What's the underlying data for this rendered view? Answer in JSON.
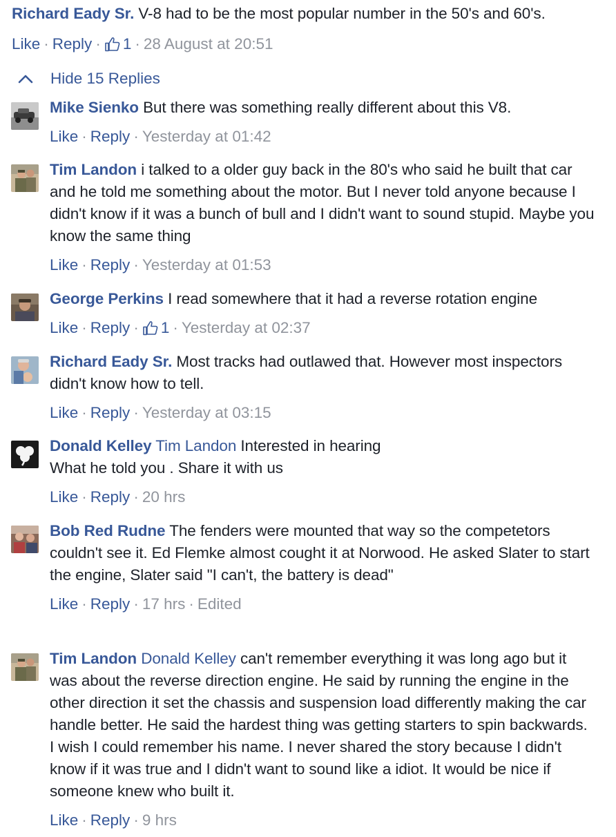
{
  "top_comment": {
    "author": "Richard Eady Sr.",
    "text": "V-8 had to be the most popular number in the 50's and 60's.",
    "like_label": "Like",
    "reply_label": "Reply",
    "like_count": "1",
    "time": "28 August at 20:51"
  },
  "hide_replies_label": "Hide 15 Replies",
  "replies": [
    {
      "author": "Mike Sienko",
      "text": "But there was something really different about this V8.",
      "like_label": "Like",
      "reply_label": "Reply",
      "time": "Yesterday at 01:42",
      "avatar_icon": "avatar-car-photo"
    },
    {
      "author": "Tim Landon",
      "text": "i talked to a older guy back in the 80's who said he built that car and he told me something about the motor. But I never told anyone because I didn't know if it was a bunch of bull and I didn't want to sound stupid. Maybe you know the same thing",
      "like_label": "Like",
      "reply_label": "Reply",
      "time": "Yesterday at 01:53",
      "avatar_icon": "avatar-soldier-photo"
    },
    {
      "author": "George Perkins",
      "text": "I read somewhere that it had a reverse rotation engine",
      "like_label": "Like",
      "reply_label": "Reply",
      "like_count": "1",
      "time": "Yesterday at 02:37",
      "avatar_icon": "avatar-man-photo"
    },
    {
      "author": "Richard Eady Sr.",
      "text": "Most tracks had outlawed that. However most inspectors didn't know how to tell.",
      "like_label": "Like",
      "reply_label": "Reply",
      "time": "Yesterday at 03:15",
      "avatar_icon": "avatar-man-child-photo"
    },
    {
      "author": "Donald Kelley",
      "mention": "Tim Landon",
      "text": "Interested in hearing\nWhat he told you . Share it with us",
      "like_label": "Like",
      "reply_label": "Reply",
      "time": "20 hrs",
      "avatar_icon": "avatar-shamrock"
    },
    {
      "author": "Bob Red Rudne",
      "text": "The fenders were mounted that way so the competetors couldn't see it. Ed Flemke almost cought it at Norwood. He asked Slater to start the engine, Slater said \"I can't, the battery is dead\"",
      "like_label": "Like",
      "reply_label": "Reply",
      "time": "17 hrs",
      "edited": "Edited",
      "avatar_icon": "avatar-people-photo"
    },
    {
      "author": "Tim Landon",
      "mention": "Donald Kelley",
      "text": "can't remember everything it was long ago but it was about the reverse direction engine. He said by running the engine in the other direction it set the chassis and suspension load differently making the car handle better. He said the hardest thing was getting starters to spin backwards. I wish I could remember his name. I never shared the story because I didn't know if it was true and I didn't want to sound like a idiot. It would be nice if someone knew who built it.",
      "like_label": "Like",
      "reply_label": "Reply",
      "time": "9 hrs",
      "avatar_icon": "avatar-soldier-photo"
    }
  ],
  "colors": {
    "link": "#385898",
    "text": "#1d2129",
    "meta": "#90949c"
  }
}
